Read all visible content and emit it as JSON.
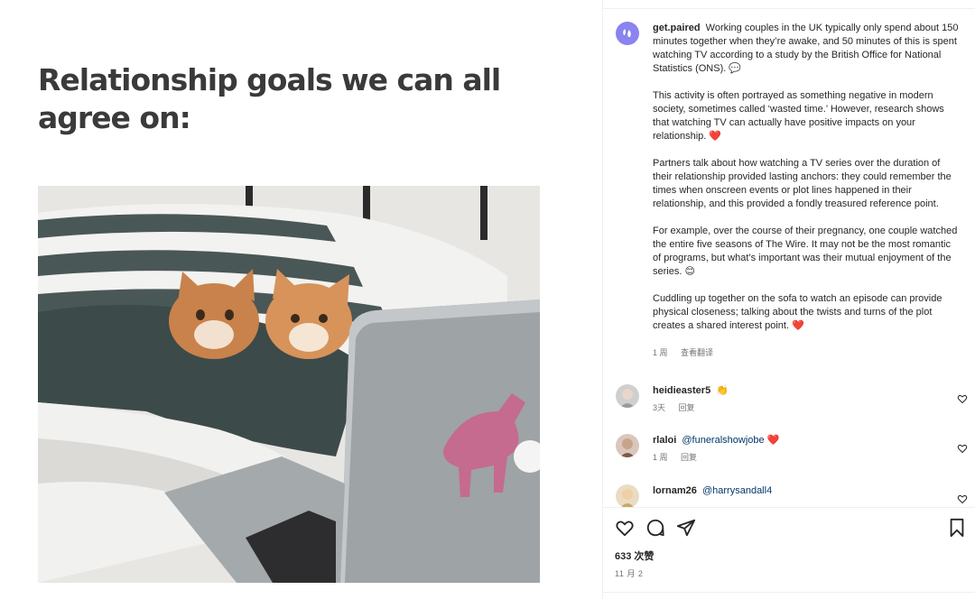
{
  "post": {
    "heading": "Relationship goals we can all agree on:"
  },
  "caption": {
    "username": "get.paired",
    "paragraphs": [
      "Working couples in the UK typically only spend about 150 minutes together when they’re awake, and 50 minutes of this is spent watching TV according to a study by the British Office for National Statistics (ONS). 💬",
      "This activity is often portrayed as something negative in modern society, sometimes called ‘wasted time.’ However, research shows that watching TV can actually have positive impacts on your relationship. ❤️",
      "Partners talk about how watching a TV series over the duration of their relationship provided lasting anchors: they could remember the times when onscreen events or plot lines happened in their relationship, and this provided a fondly treasured reference point.",
      "For example, over the course of their pregnancy, one couple watched the entire five seasons of The Wire. It may not be the most romantic of programs, but what’s important was their mutual enjoyment of the series. 😊",
      "Cuddling up together on the sofa to watch an episode can provide physical closeness; talking about the twists and turns of the plot creates a shared interest point. ❤️"
    ],
    "time": "1 周",
    "translate": "查看翻译"
  },
  "comments": [
    {
      "username": "heidieaster5",
      "text": "👏",
      "mention": "",
      "time": "3天",
      "reply": "回复"
    },
    {
      "username": "rlaloi",
      "text": "❤️",
      "mention": "@funeralshowjobe",
      "time": "1 周",
      "reply": "回复"
    },
    {
      "username": "lornam26",
      "text": "",
      "mention": "@harrysandall4",
      "time": "",
      "reply": ""
    }
  ],
  "footer": {
    "likes": "633 次赞",
    "date": "11 月 2"
  },
  "icons": {
    "like": "heart-outline-icon",
    "comment": "speech-bubble-icon",
    "share": "paper-plane-icon",
    "save": "bookmark-icon"
  },
  "colors": {
    "avatar_brand": "#8a83f0",
    "mention": "#00376b",
    "meta": "#737373"
  }
}
